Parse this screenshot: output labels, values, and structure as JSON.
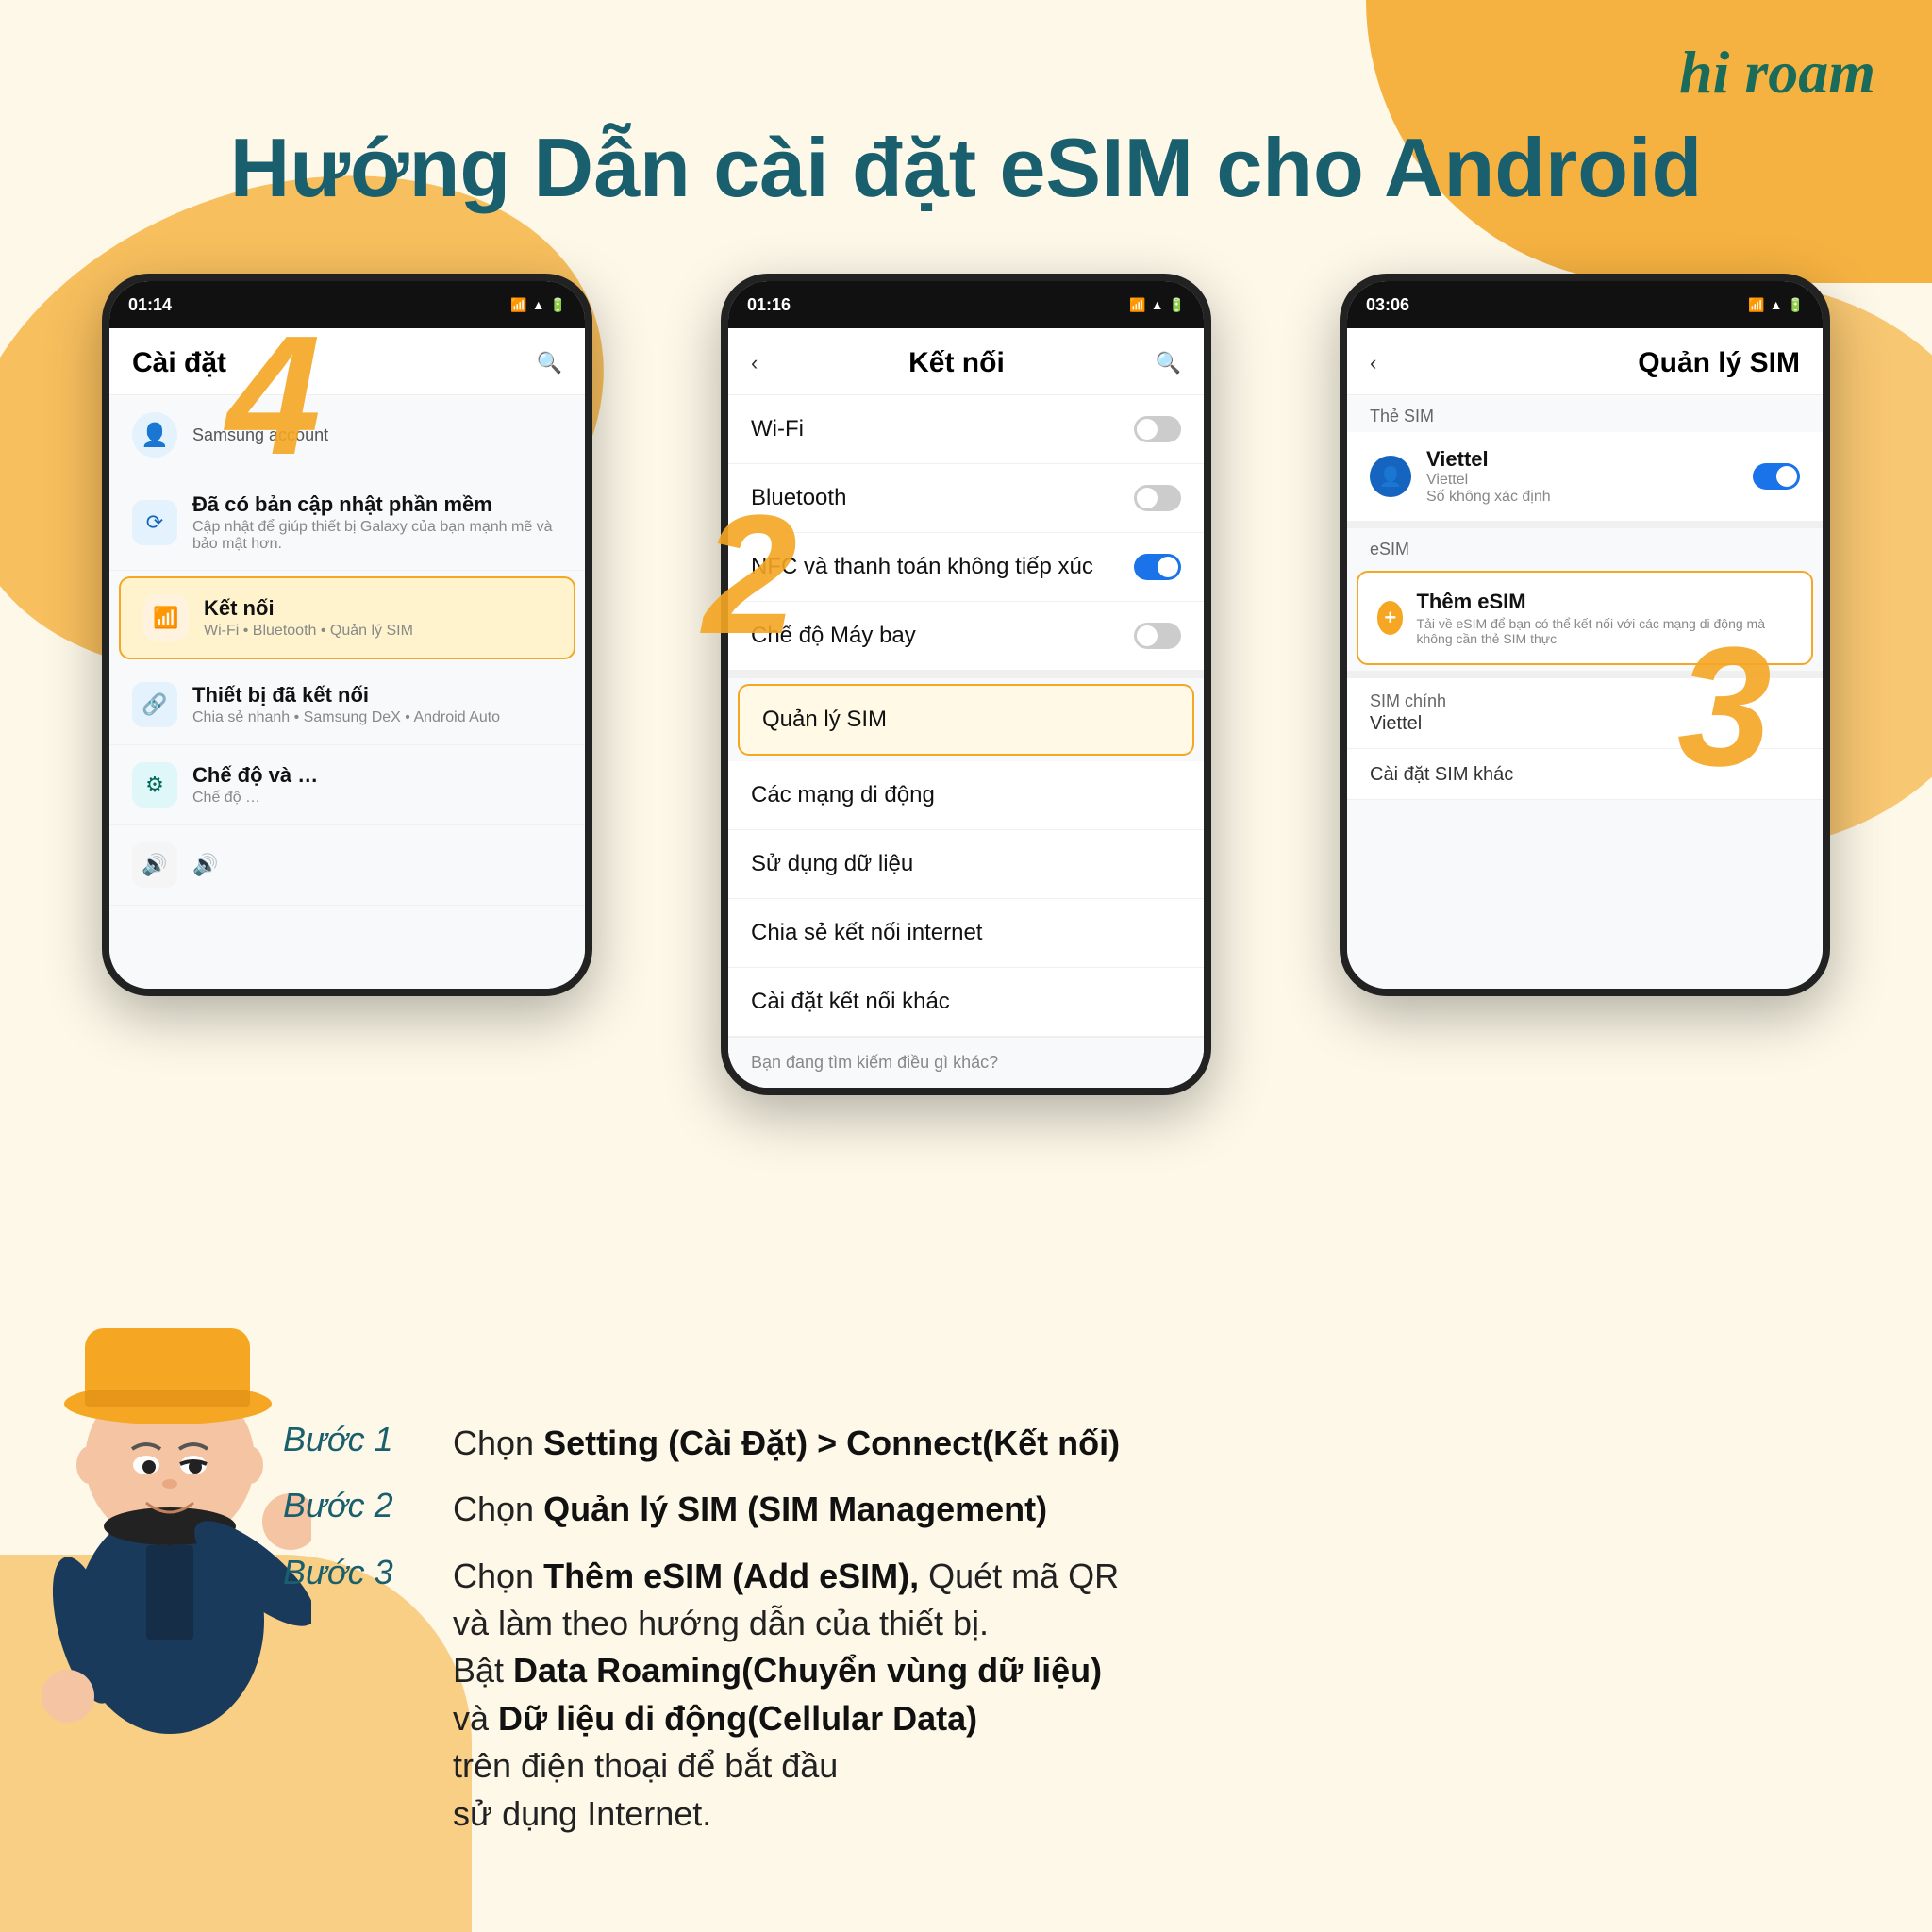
{
  "page": {
    "background_color": "#fdf8e8",
    "accent_color": "#f5a623",
    "title_color": "#1a5f6e"
  },
  "logo": {
    "text": "hi roam",
    "hi": "hi",
    "roam": "roam"
  },
  "main_title": "Hướng Dẫn cài đặt eSIM cho Android",
  "phones": [
    {
      "id": "phone1",
      "time": "01:14",
      "screen_title": "Cài đặt",
      "items": [
        {
          "label": "Samsung account",
          "subtitle": "",
          "type": "account"
        },
        {
          "label": "Đã có bản cập nhật phần mềm",
          "subtitle": "Cập nhật để giúp thiết bị Galaxy của bạn mạnh mẽ và bảo mật hơn.",
          "icon": "⟳",
          "icon_color": "blue"
        },
        {
          "label": "Kết nối",
          "subtitle": "Wi-Fi • Bluetooth • Quản lý SIM",
          "icon": "📶",
          "icon_color": "orange",
          "highlighted": true
        },
        {
          "label": "Thiết bị đã kết nối",
          "subtitle": "Chia sẻ nhanh • Samsung DeX • Android Auto",
          "icon": "🔗",
          "icon_color": "blue"
        },
        {
          "label": "Chế độ và …",
          "subtitle": "Chế độ …",
          "icon": "⚙",
          "icon_color": "teal"
        },
        {
          "label": "🔊",
          "subtitle": "",
          "icon": "🔊",
          "icon_color": "gray"
        }
      ]
    },
    {
      "id": "phone2",
      "time": "01:16",
      "screen_title": "Kết nối",
      "back": true,
      "items": [
        {
          "label": "Wi-Fi",
          "type": "toggle",
          "toggle_state": "off"
        },
        {
          "label": "Bluetooth",
          "type": "toggle",
          "toggle_state": "off"
        },
        {
          "label": "NFC và thanh toán không tiếp xúc",
          "type": "toggle",
          "toggle_state": "on"
        },
        {
          "label": "Chế độ Máy bay",
          "type": "toggle",
          "toggle_state": "off"
        },
        {
          "label": "Quản lý SIM",
          "type": "link",
          "highlighted": true
        },
        {
          "label": "Các mạng di động",
          "type": "link"
        },
        {
          "label": "Sử dụng dữ liệu",
          "type": "link"
        },
        {
          "label": "Chia sẻ kết nối internet",
          "type": "link"
        },
        {
          "label": "Cài đặt kết nối khác",
          "type": "link"
        }
      ],
      "footer": "Bạn đang tìm kiếm điều gì khác?"
    },
    {
      "id": "phone3",
      "time": "03:06",
      "screen_title": "Quản lý SIM",
      "back": true,
      "sim_section": "Thẻ SIM",
      "sim_card": {
        "name": "Viettel",
        "detail": "Viettel",
        "detail2": "Số không xác định",
        "toggle_state": "on"
      },
      "esim_section": "eSIM",
      "esim_add": {
        "label": "Thêm eSIM",
        "sublabel": "Tải về eSIM để bạn có thể kết nối với các mạng di động mà không cần thẻ SIM thực"
      },
      "sim_main": {
        "label": "SIM chính",
        "value": "Viettel"
      },
      "other_settings": "Cài đặt SIM khác"
    }
  ],
  "step_numbers": [
    "4",
    "2",
    "3"
  ],
  "instructions": [
    {
      "step": "Bước 1",
      "text_plain": "Chọn ",
      "text_bold": "Setting (Cài Đặt) > Connect(Kết nối)"
    },
    {
      "step": "Bước 2",
      "text_plain": "Chọn ",
      "text_bold": "Quản lý SIM (SIM Management)"
    },
    {
      "step": "Bước 3",
      "text_plain": "Chọn ",
      "text_bold": "Thêm eSIM (Add eSIM),",
      "text_plain2": " Quét mã QR",
      "text_line2": "và làm theo hướng dẫn của thiết bị.",
      "text_line3_plain": "Bật ",
      "text_line3_bold": "Data Roaming(Chuyển vùng dữ liệu)",
      "text_line4_plain": "và ",
      "text_line4_bold": "Dữ liệu di động(Cellular Data)",
      "text_line5": "trên điện thoại để bắt đầu",
      "text_line6": "sử dụng Internet."
    }
  ]
}
